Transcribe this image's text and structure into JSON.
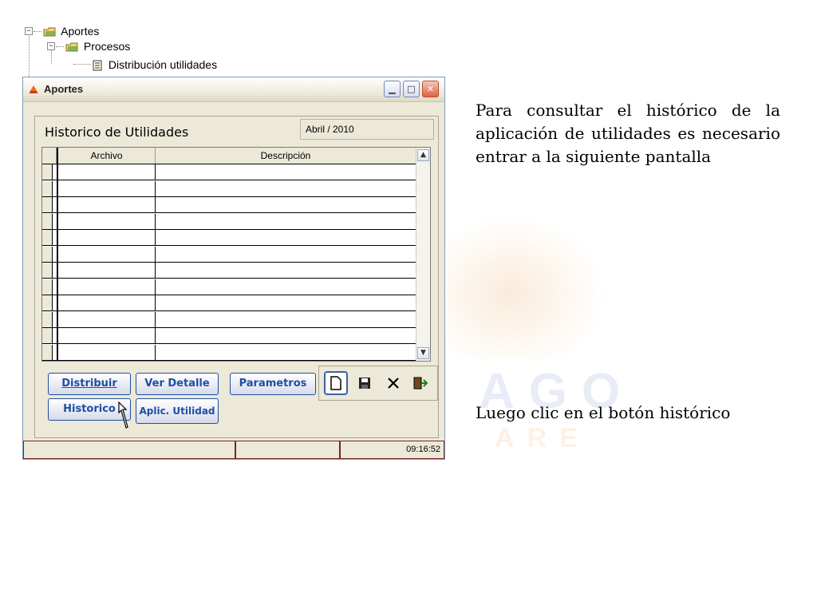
{
  "tree": {
    "root": "Aportes",
    "child": "Procesos",
    "leaf": "Distribución utilidades"
  },
  "window": {
    "title": "Aportes",
    "form_title": "Historico de Utilidades",
    "period": "Abril / 2010",
    "grid": {
      "columns": [
        "Archivo",
        "Descripción"
      ],
      "rows": [
        [
          "",
          ""
        ],
        [
          "",
          ""
        ],
        [
          "",
          ""
        ],
        [
          "",
          ""
        ],
        [
          "",
          ""
        ],
        [
          "",
          ""
        ],
        [
          "",
          ""
        ],
        [
          "",
          ""
        ],
        [
          "",
          ""
        ],
        [
          "",
          ""
        ],
        [
          "",
          ""
        ],
        [
          "",
          ""
        ]
      ]
    },
    "buttons": {
      "distribuir": "Distribuir",
      "ver_detalle": "Ver Detalle",
      "parametros": "Parametros",
      "historico": "Historico",
      "aplic_utilidad": "Aplic. Utilidad"
    },
    "status": {
      "time": "09:16:52"
    }
  },
  "text": {
    "paragraph1": "Para consultar el histórico de la aplicación de utilidades es necesario entrar a la siguiente pantalla",
    "paragraph2": "Luego clic en el botón histórico"
  },
  "colors": {
    "button_text": "#1f4ea3",
    "window_bg": "#ece9d8",
    "close_button": "#e2603d"
  },
  "icons": [
    "folder-icon",
    "document-icon",
    "app-icon",
    "minimize-icon",
    "maximize-icon",
    "close-icon",
    "new-icon",
    "save-icon",
    "delete-icon",
    "exit-icon",
    "mouse-cursor-icon"
  ]
}
